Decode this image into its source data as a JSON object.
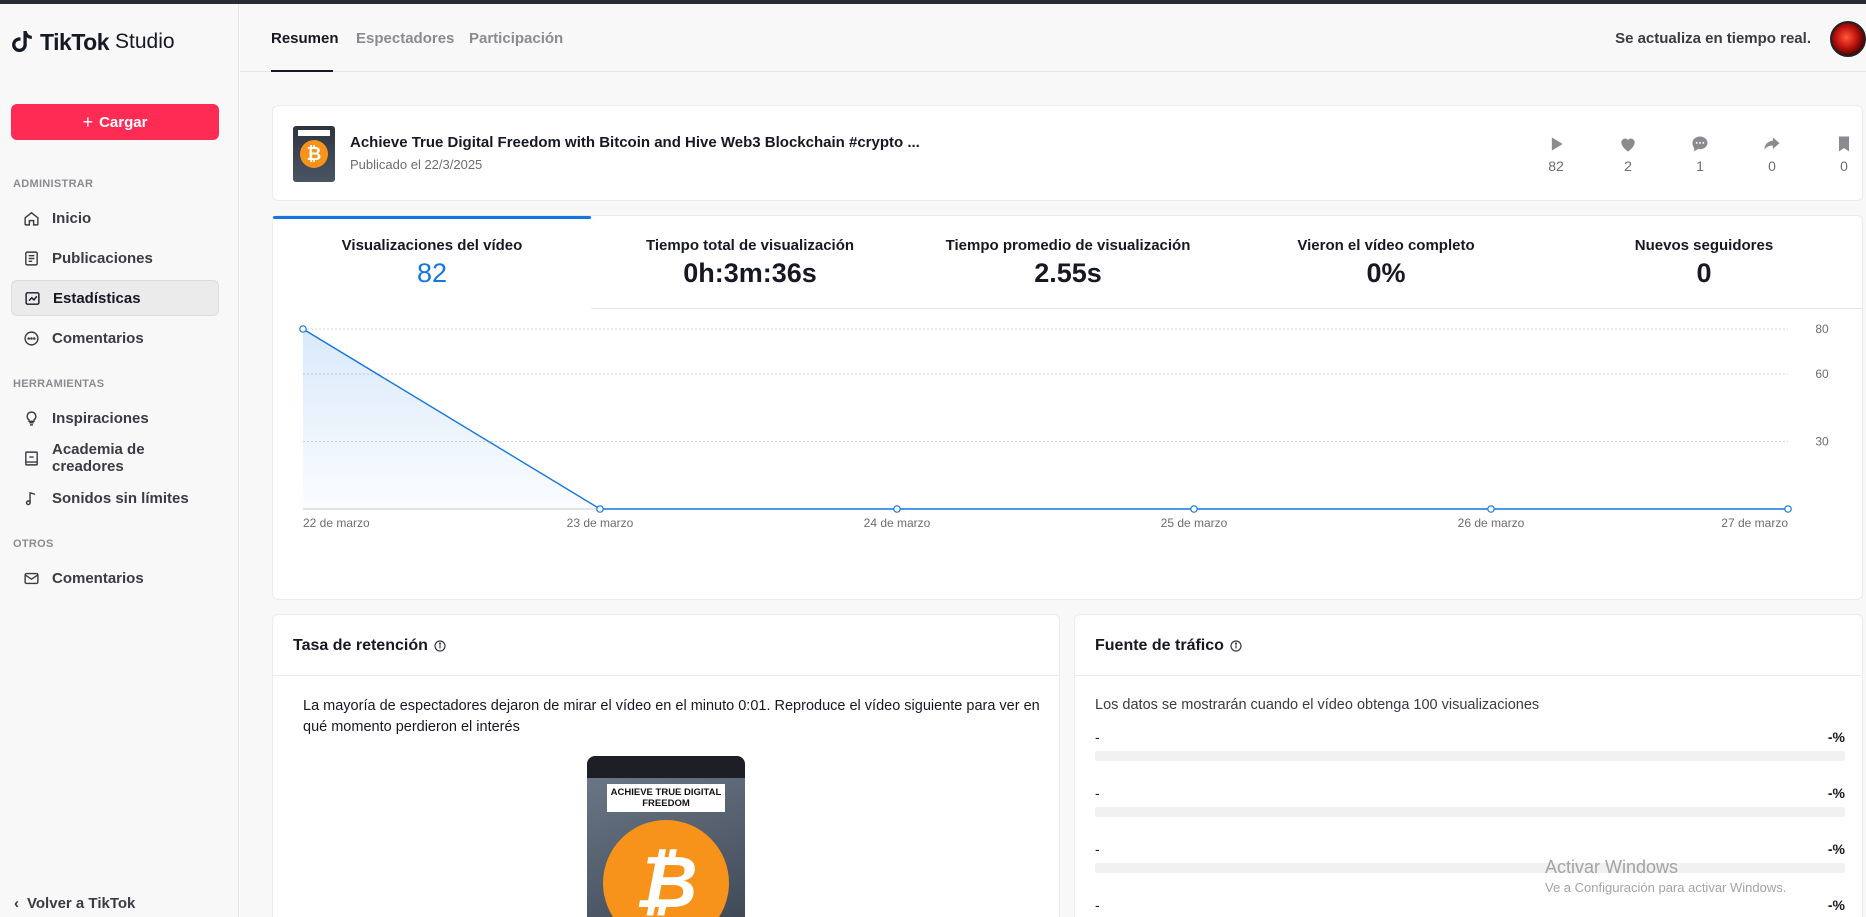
{
  "app": {
    "brand": "TikTok",
    "brand_suffix": "Studio"
  },
  "sidebar": {
    "upload_label": "Cargar",
    "sections": {
      "manage": "ADMINISTRAR",
      "tools": "HERRAMIENTAS",
      "others": "OTROS"
    },
    "items": [
      {
        "label": "Inicio",
        "icon": "home-icon"
      },
      {
        "label": "Publicaciones",
        "icon": "posts-icon"
      },
      {
        "label": "Estadísticas",
        "icon": "analytics-icon"
      },
      {
        "label": "Comentarios",
        "icon": "comment-icon"
      },
      {
        "label": "Inspiraciones",
        "icon": "lightbulb-icon"
      },
      {
        "label": "Academia de creadores",
        "icon": "book-icon"
      },
      {
        "label": "Sonidos sin límites",
        "icon": "music-note-icon"
      },
      {
        "label": "Comentarios",
        "icon": "mail-icon"
      }
    ],
    "back_label": "Volver a TikTok"
  },
  "header": {
    "tabs": [
      "Resumen",
      "Espectadores",
      "Participación"
    ],
    "realtime": "Se actualiza en tiempo real."
  },
  "video": {
    "title": "Achieve True Digital Freedom with Bitcoin and Hive Web3 Blockchain #crypto ...",
    "published": "Publicado el 22/3/2025",
    "stats": {
      "views": "82",
      "likes": "2",
      "comments": "1",
      "shares": "0",
      "saves": "0"
    }
  },
  "metrics": [
    {
      "label": "Visualizaciones del vídeo",
      "value": "82"
    },
    {
      "label": "Tiempo total de visualización",
      "value": "0h:3m:36s"
    },
    {
      "label": "Tiempo promedio de visualización",
      "value": "2.55s"
    },
    {
      "label": "Vieron el vídeo completo",
      "value": "0%"
    },
    {
      "label": "Nuevos seguidores",
      "value": "0"
    }
  ],
  "chart_data": {
    "type": "area",
    "categories": [
      "22 de marzo",
      "23 de marzo",
      "24 de marzo",
      "25 de marzo",
      "26 de marzo",
      "27 de marzo"
    ],
    "values": [
      80,
      0,
      0,
      0,
      0,
      0
    ],
    "yticks": [
      30,
      60,
      80
    ],
    "ylim": [
      0,
      80
    ],
    "grid": true,
    "yaxis_side": "right",
    "color": "#1476e0"
  },
  "retention": {
    "title": "Tasa de retención",
    "text": "La mayoría de espectadores dejaron de mirar el vídeo en el minuto 0:01. Reproduce el vídeo siguiente para ver en qué momento perdieron el interés",
    "thumb_banner": "ACHIEVE TRUE DIGITAL FREEDOM"
  },
  "traffic": {
    "title": "Fuente de tráfico",
    "note": "Los datos se mostrarán cuando el vídeo obtenga 100 visualizaciones",
    "rows": [
      {
        "label": "-",
        "value": "-%"
      },
      {
        "label": "-",
        "value": "-%"
      },
      {
        "label": "-",
        "value": "-%"
      },
      {
        "label": "-",
        "value": "-%"
      }
    ]
  },
  "watermark": {
    "line1": "Activar Windows",
    "line2": "Ve a Configuración para activar Windows."
  }
}
